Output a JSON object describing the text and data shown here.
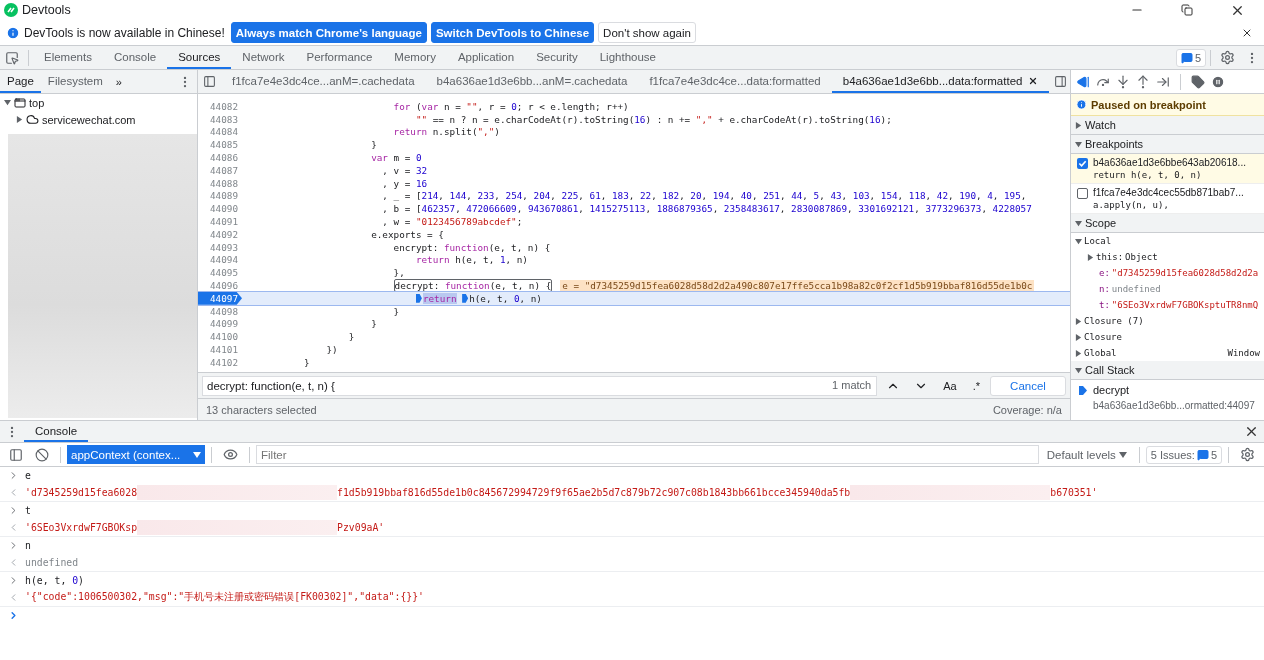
{
  "title_bar": {
    "title": "Devtools"
  },
  "infobar": {
    "message": "DevTools is now available in Chinese!",
    "buttons": [
      {
        "label": "Always match Chrome's language",
        "kind": "primary"
      },
      {
        "label": "Switch DevTools to Chinese",
        "kind": "primary"
      },
      {
        "label": "Don't show again",
        "kind": "secondary"
      }
    ]
  },
  "main_tabs": [
    {
      "label": "Elements",
      "selected": false
    },
    {
      "label": "Console",
      "selected": false
    },
    {
      "label": "Sources",
      "selected": true
    },
    {
      "label": "Network",
      "selected": false
    },
    {
      "label": "Performance",
      "selected": false
    },
    {
      "label": "Memory",
      "selected": false
    },
    {
      "label": "Application",
      "selected": false
    },
    {
      "label": "Security",
      "selected": false
    },
    {
      "label": "Lighthouse",
      "selected": false
    }
  ],
  "issues_count": "5",
  "navigator": {
    "tabs": [
      {
        "label": "Page",
        "selected": true
      },
      {
        "label": "Filesystem",
        "selected": false
      }
    ],
    "more": "»",
    "tree": [
      {
        "label": "top",
        "kind": "frame",
        "expanded": true,
        "children": [
          {
            "label": "servicewechat.com",
            "kind": "domain",
            "expanded": false
          }
        ]
      }
    ],
    "redacted": true
  },
  "editor": {
    "tabs": [
      {
        "label": "f1fca7e4e3dc4ce...anM=.cachedata",
        "selected": false
      },
      {
        "label": "b4a636ae1d3e6bb...anM=.cachedata",
        "selected": false
      },
      {
        "label": "f1fca7e4e3dc4ce...data:formatted",
        "selected": false
      },
      {
        "label": "b4a636ae1d3e6bb...data:formatted",
        "selected": true
      }
    ],
    "lines": [
      {
        "number": "44082",
        "current": false,
        "code": [
          {
            "kind": "kw",
            "text": "                          for"
          },
          {
            "kind": "txt",
            "text": " ("
          },
          {
            "kind": "kw",
            "text": "var"
          },
          {
            "kind": "txt",
            "text": " n = "
          },
          {
            "kind": "str",
            "text": "\"\""
          },
          {
            "kind": "txt",
            "text": ", r = "
          },
          {
            "kind": "num",
            "text": "0"
          },
          {
            "kind": "txt",
            "text": "; r < e.length; r++)"
          }
        ]
      },
      {
        "number": "44083",
        "current": false,
        "code": [
          {
            "kind": "str",
            "text": "                              \"\""
          },
          {
            "kind": "txt",
            "text": " == n ? n = e.charCodeAt(r).toString("
          },
          {
            "kind": "num",
            "text": "16"
          },
          {
            "kind": "txt",
            "text": ") : n += "
          },
          {
            "kind": "str",
            "text": "\",\""
          },
          {
            "kind": "txt",
            "text": " + e.charCodeAt(r).toString("
          },
          {
            "kind": "num",
            "text": "16"
          },
          {
            "kind": "txt",
            "text": ");"
          }
        ]
      },
      {
        "number": "44084",
        "current": false,
        "code": [
          {
            "kind": "kw",
            "text": "                          return"
          },
          {
            "kind": "txt",
            "text": " n.split("
          },
          {
            "kind": "str",
            "text": "\",\""
          },
          {
            "kind": "txt",
            "text": ")"
          }
        ]
      },
      {
        "number": "44085",
        "current": false,
        "code": [
          {
            "kind": "txt",
            "text": "                      }"
          }
        ]
      },
      {
        "number": "44086",
        "current": false,
        "code": [
          {
            "kind": "kw",
            "text": "                      var"
          },
          {
            "kind": "txt",
            "text": " m = "
          },
          {
            "kind": "num",
            "text": "0"
          }
        ]
      },
      {
        "number": "44087",
        "current": false,
        "code": [
          {
            "kind": "txt",
            "text": "                        , v = "
          },
          {
            "kind": "num",
            "text": "32"
          }
        ]
      },
      {
        "number": "44088",
        "current": false,
        "code": [
          {
            "kind": "txt",
            "text": "                        , y = "
          },
          {
            "kind": "num",
            "text": "16"
          }
        ]
      },
      {
        "number": "44089",
        "current": false,
        "code": [
          {
            "kind": "txt",
            "text": "                        , _ = ["
          },
          {
            "kind": "num",
            "text": "214"
          },
          {
            "kind": "txt",
            "text": ", "
          },
          {
            "kind": "num",
            "text": "144"
          },
          {
            "kind": "txt",
            "text": ", "
          },
          {
            "kind": "num",
            "text": "233"
          },
          {
            "kind": "txt",
            "text": ", "
          },
          {
            "kind": "num",
            "text": "254"
          },
          {
            "kind": "txt",
            "text": ", "
          },
          {
            "kind": "num",
            "text": "204"
          },
          {
            "kind": "txt",
            "text": ", "
          },
          {
            "kind": "num",
            "text": "225"
          },
          {
            "kind": "txt",
            "text": ", "
          },
          {
            "kind": "num",
            "text": "61"
          },
          {
            "kind": "txt",
            "text": ", "
          },
          {
            "kind": "num",
            "text": "183"
          },
          {
            "kind": "txt",
            "text": ", "
          },
          {
            "kind": "num",
            "text": "22"
          },
          {
            "kind": "txt",
            "text": ", "
          },
          {
            "kind": "num",
            "text": "182"
          },
          {
            "kind": "txt",
            "text": ", "
          },
          {
            "kind": "num",
            "text": "20"
          },
          {
            "kind": "txt",
            "text": ", "
          },
          {
            "kind": "num",
            "text": "194"
          },
          {
            "kind": "txt",
            "text": ", "
          },
          {
            "kind": "num",
            "text": "40"
          },
          {
            "kind": "txt",
            "text": ", "
          },
          {
            "kind": "num",
            "text": "251"
          },
          {
            "kind": "txt",
            "text": ", "
          },
          {
            "kind": "num",
            "text": "44"
          },
          {
            "kind": "txt",
            "text": ", "
          },
          {
            "kind": "num",
            "text": "5"
          },
          {
            "kind": "txt",
            "text": ", "
          },
          {
            "kind": "num",
            "text": "43"
          },
          {
            "kind": "txt",
            "text": ", "
          },
          {
            "kind": "num",
            "text": "103"
          },
          {
            "kind": "txt",
            "text": ", "
          },
          {
            "kind": "num",
            "text": "154"
          },
          {
            "kind": "txt",
            "text": ", "
          },
          {
            "kind": "num",
            "text": "118"
          },
          {
            "kind": "txt",
            "text": ", "
          },
          {
            "kind": "num",
            "text": "42"
          },
          {
            "kind": "txt",
            "text": ", "
          },
          {
            "kind": "num",
            "text": "190"
          },
          {
            "kind": "txt",
            "text": ", "
          },
          {
            "kind": "num",
            "text": "4"
          },
          {
            "kind": "txt",
            "text": ", "
          },
          {
            "kind": "num",
            "text": "195"
          },
          {
            "kind": "txt",
            "text": ","
          }
        ]
      },
      {
        "number": "44090",
        "current": false,
        "code": [
          {
            "kind": "txt",
            "text": "                        , b = ["
          },
          {
            "kind": "num",
            "text": "462357"
          },
          {
            "kind": "txt",
            "text": ", "
          },
          {
            "kind": "num",
            "text": "472066609"
          },
          {
            "kind": "txt",
            "text": ", "
          },
          {
            "kind": "num",
            "text": "943670861"
          },
          {
            "kind": "txt",
            "text": ", "
          },
          {
            "kind": "num",
            "text": "1415275113"
          },
          {
            "kind": "txt",
            "text": ", "
          },
          {
            "kind": "num",
            "text": "1886879365"
          },
          {
            "kind": "txt",
            "text": ", "
          },
          {
            "kind": "num",
            "text": "2358483617"
          },
          {
            "kind": "txt",
            "text": ", "
          },
          {
            "kind": "num",
            "text": "2830087869"
          },
          {
            "kind": "txt",
            "text": ", "
          },
          {
            "kind": "num",
            "text": "3301692121"
          },
          {
            "kind": "txt",
            "text": ", "
          },
          {
            "kind": "num",
            "text": "3773296373"
          },
          {
            "kind": "txt",
            "text": ", "
          },
          {
            "kind": "num",
            "text": "4228057"
          }
        ]
      },
      {
        "number": "44091",
        "current": false,
        "code": [
          {
            "kind": "txt",
            "text": "                        , w = "
          },
          {
            "kind": "str",
            "text": "\"0123456789abcdef\""
          },
          {
            "kind": "txt",
            "text": ";"
          }
        ]
      },
      {
        "number": "44092",
        "current": false,
        "code": [
          {
            "kind": "txt",
            "text": "                      e.exports = {"
          }
        ]
      },
      {
        "number": "44093",
        "current": false,
        "code": [
          {
            "kind": "txt",
            "text": "                          encrypt: "
          },
          {
            "kind": "kw",
            "text": "function"
          },
          {
            "kind": "txt",
            "text": "(e, t, n) {"
          }
        ]
      },
      {
        "number": "44094",
        "current": false,
        "code": [
          {
            "kind": "kw",
            "text": "                              return"
          },
          {
            "kind": "txt",
            "text": " h(e, t, "
          },
          {
            "kind": "num",
            "text": "1"
          },
          {
            "kind": "txt",
            "text": ", n)"
          }
        ]
      },
      {
        "number": "44095",
        "current": false,
        "code": [
          {
            "kind": "txt",
            "text": "                          },"
          }
        ]
      },
      {
        "number": "44096",
        "current": false,
        "code": [
          {
            "kind": "txt",
            "text": "                          decrypt: ",
            "boxed": true
          },
          {
            "kind": "kw",
            "text": "function",
            "boxed": true
          },
          {
            "kind": "txt",
            "text": "(e, t, n) {",
            "boxed": true
          }
        ],
        "inline_value": "e = \"d7345259d15fea6028d58d2d2a490c807e17ffe5cca1b98a82c0f2cf1d5b919bbaf816d55de1b0c"
      },
      {
        "number": "44097",
        "current": true,
        "code": [
          {
            "kind": "kw",
            "text": "                              return",
            "highlighted": true,
            "stop": true
          },
          {
            "kind": "txt",
            "text": " h(e, t, ",
            "stop": true
          },
          {
            "kind": "num",
            "text": "0"
          },
          {
            "kind": "txt",
            "text": ", n)"
          }
        ]
      },
      {
        "number": "44098",
        "current": false,
        "code": [
          {
            "kind": "txt",
            "text": "                          }"
          }
        ]
      },
      {
        "number": "44099",
        "current": false,
        "code": [
          {
            "kind": "txt",
            "text": "                      }"
          }
        ]
      },
      {
        "number": "44100",
        "current": false,
        "code": [
          {
            "kind": "txt",
            "text": "                  }"
          }
        ]
      },
      {
        "number": "44101",
        "current": false,
        "code": [
          {
            "kind": "txt",
            "text": "              })"
          }
        ]
      },
      {
        "number": "44102",
        "current": false,
        "code": [
          {
            "kind": "txt",
            "text": "          }"
          }
        ]
      }
    ],
    "search": {
      "value": "decrypt: function(e, t, n) {",
      "matches": "1 match",
      "case_button": "Aa",
      "regex_button": ".*",
      "cancel": "Cancel"
    },
    "status": {
      "selection": "13 characters selected",
      "coverage": "Coverage: n/a"
    }
  },
  "debugger": {
    "paused_message": "Paused on breakpoint",
    "watch": {
      "title": "Watch",
      "expanded": false
    },
    "breakpoints": {
      "title": "Breakpoints",
      "expanded": true,
      "items": [
        {
          "file": "b4a636ae1d3e6bbe643ab20618...",
          "code": "return h(e, t, 0, n)",
          "checked": true,
          "selected": true
        },
        {
          "file": "f1fca7e4e3dc4cec55db871bab7...",
          "code": "a.apply(n, u),",
          "checked": false,
          "selected": false
        }
      ]
    },
    "scope": {
      "title": "Scope",
      "expanded": true,
      "items": [
        {
          "label": "Local",
          "expanded": true,
          "children": [
            {
              "name": "this:",
              "value": "Object",
              "kind": "object",
              "expanded": false
            },
            {
              "name": "e:",
              "value": "\"d7345259d15fea6028d58d2d2a",
              "kind": "string"
            },
            {
              "name": "n:",
              "value": "undefined",
              "kind": "undefined"
            },
            {
              "name": "t:",
              "value": "\"6SEo3VxrdwF7GBOKsptuTR8nmQ",
              "kind": "string"
            }
          ]
        },
        {
          "label": "Closure (7)",
          "expanded": false
        },
        {
          "label": "Closure",
          "expanded": false
        },
        {
          "label": "Global",
          "value": "Window",
          "expanded": false
        }
      ]
    },
    "call_stack": {
      "title": "Call Stack",
      "expanded": true,
      "frames": [
        {
          "function": "decrypt",
          "location": "b4a636ae1d3e6bb...ormatted:44097",
          "current": true
        }
      ]
    }
  },
  "drawer": {
    "tabs": [
      {
        "label": "Console",
        "selected": true
      }
    ],
    "context": "appContext (contex...",
    "filter_placeholder": "Filter",
    "levels": "Default levels",
    "issues_label": "5 Issues:",
    "issues_count": "5",
    "entries": [
      {
        "kind": "input",
        "parts": [
          {
            "kind": "txt",
            "text": "e"
          }
        ]
      },
      {
        "kind": "output",
        "parts": [
          {
            "kind": "str",
            "text": "'d7345259d15fea6028"
          },
          {
            "kind": "redacted"
          },
          {
            "kind": "str",
            "text": "f1d5b919bbaf816d55de1b0c845672994729f9f65ae2b5d7c879b72c907c08b1843bb661bcce345940da5fb"
          },
          {
            "kind": "redacted"
          },
          {
            "kind": "str",
            "text": "b670351'"
          }
        ]
      },
      {
        "kind": "input",
        "parts": [
          {
            "kind": "txt",
            "text": "t"
          }
        ]
      },
      {
        "kind": "output",
        "parts": [
          {
            "kind": "str",
            "text": "'6SEo3VxrdwF7GBOKsp"
          },
          {
            "kind": "redacted"
          },
          {
            "kind": "str",
            "text": "Pzv09aA'"
          }
        ]
      },
      {
        "kind": "input",
        "parts": [
          {
            "kind": "txt",
            "text": "n"
          }
        ]
      },
      {
        "kind": "output",
        "parts": [
          {
            "kind": "undef",
            "text": "undefined"
          }
        ]
      },
      {
        "kind": "input",
        "parts": [
          {
            "kind": "txt",
            "text": "h(e, t, "
          },
          {
            "kind": "num",
            "text": "0"
          },
          {
            "kind": "txt",
            "text": ")"
          }
        ]
      },
      {
        "kind": "output",
        "parts": [
          {
            "kind": "str",
            "text": "'{\"code\":1006500302,\"msg\":\"手机号未注册或密码错误[FK00302]\",\"data\":{}}'"
          }
        ]
      },
      {
        "kind": "prompt"
      }
    ]
  }
}
